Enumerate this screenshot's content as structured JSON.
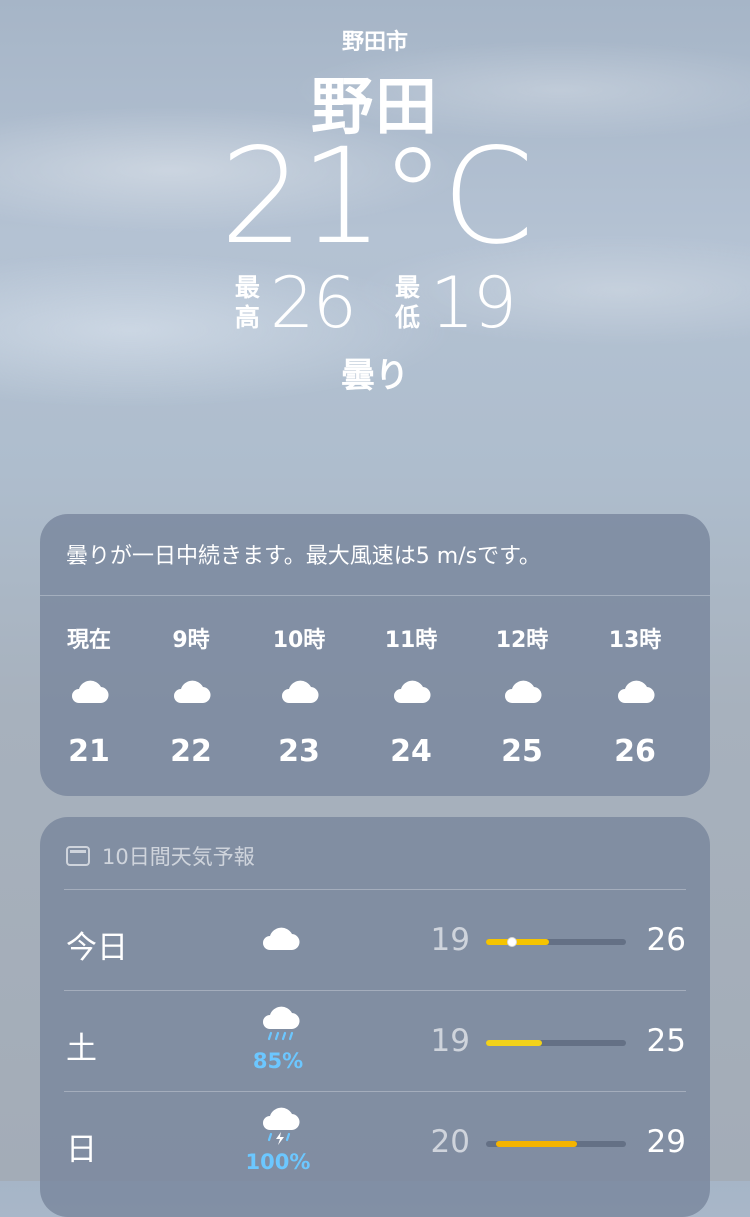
{
  "location": {
    "area": "野田市",
    "city": "野田"
  },
  "current": {
    "temperature": "21°C",
    "high_label_top": "最",
    "high_label_bottom": "高",
    "high": "26",
    "low_label_top": "最",
    "low_label_bottom": "低",
    "low": "19",
    "condition": "曇り"
  },
  "hourly": {
    "summary": "曇りが一日中続きます。最大風速は5 m/sです。",
    "items": [
      {
        "label": "現在",
        "icon": "cloud-icon",
        "temp": "21"
      },
      {
        "label": "9時",
        "icon": "cloud-icon",
        "temp": "22"
      },
      {
        "label": "10時",
        "icon": "cloud-icon",
        "temp": "23"
      },
      {
        "label": "11時",
        "icon": "cloud-icon",
        "temp": "24"
      },
      {
        "label": "12時",
        "icon": "cloud-icon",
        "temp": "25"
      },
      {
        "label": "13時",
        "icon": "cloud-icon",
        "temp": "26"
      }
    ]
  },
  "daily": {
    "title": "10日間天気予報",
    "days": [
      {
        "day": "今日",
        "icon": "cloud-icon",
        "precip": "",
        "low": "19",
        "high": "26",
        "range_start": 0.0,
        "range_end": 0.45,
        "current_marker": 0.15
      },
      {
        "day": "土",
        "icon": "cloud-rain-icon",
        "precip": "85%",
        "low": "19",
        "high": "25",
        "range_start": 0.0,
        "range_end": 0.4
      },
      {
        "day": "日",
        "icon": "cloud-thunderstorm-icon",
        "precip": "100%",
        "low": "20",
        "high": "29",
        "range_start": 0.07,
        "range_end": 0.65
      }
    ]
  },
  "colors": {
    "bar_fill_today": "#f5c400",
    "bar_fill_sat": "#f2d21a",
    "bar_fill_sun": "#f5b400",
    "precip_text": "#6cc7ff"
  }
}
